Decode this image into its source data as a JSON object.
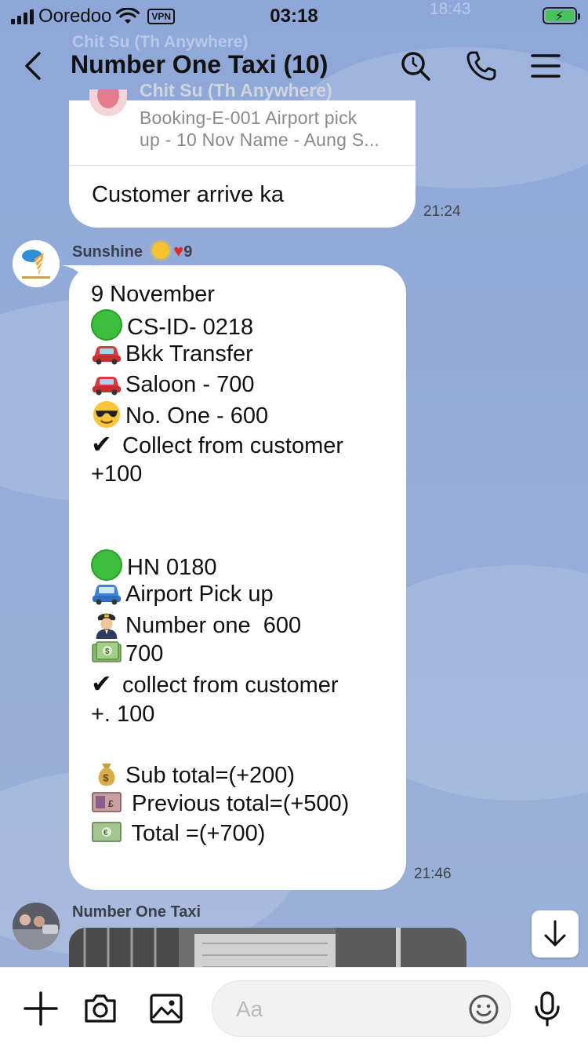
{
  "status_bar": {
    "carrier": "Ooredoo",
    "vpn": "VPN",
    "time": "03:18"
  },
  "ghost_texts": {
    "top_name": "Chit Su (Th Anywhere)",
    "top_time": "18:43"
  },
  "header": {
    "title": "Number One Taxi (10)"
  },
  "messages": {
    "quoted": {
      "sender": "Chit Su (Th Anywhere)",
      "quote_line1": "Booking-E-001 Airport pick",
      "quote_line2": "up - 10 Nov Name - Aung S...",
      "reply": "Customer arrive ka",
      "time": "21:24"
    },
    "sunshine": {
      "sender": "Sunshine",
      "sender_suffix": "9",
      "time": "21:46",
      "lines": [
        {
          "icon": "",
          "text": "9 November"
        },
        {
          "icon": "green-circle",
          "text": "CS-ID- 0218"
        },
        {
          "icon": "car",
          "text": "Bkk Transfer"
        },
        {
          "icon": "car",
          "text": "Saloon - 700"
        },
        {
          "icon": "sunglasses-face",
          "text": "No. One - 600"
        },
        {
          "icon": "check",
          "text": "Collect from customer"
        },
        {
          "icon": "",
          "text": "+100"
        },
        {
          "icon": "",
          "text": ""
        },
        {
          "icon": "",
          "text": ""
        },
        {
          "icon": "green-circle",
          "text": "HN 0180"
        },
        {
          "icon": "blue-car",
          "text": "Airport Pick up"
        },
        {
          "icon": "pilot",
          "text": "Number one  600"
        },
        {
          "icon": "dollar-bill",
          "text": "700"
        },
        {
          "icon": "check",
          "text": "collect from customer"
        },
        {
          "icon": "",
          "text": "+. 100"
        },
        {
          "icon": "",
          "text": ""
        },
        {
          "icon": "money-bag",
          "text": "Sub total=(+200)"
        },
        {
          "icon": "pound-bill",
          "text": " Previous total=(+500)"
        },
        {
          "icon": "euro-bill",
          "text": " Total =(+700)"
        }
      ]
    },
    "next": {
      "sender": "Number One Taxi"
    }
  },
  "composer": {
    "placeholder": "Aa"
  },
  "colors": {
    "background": "#8fa8d6",
    "bubble": "#ffffff",
    "green": "#3cbf3c"
  }
}
